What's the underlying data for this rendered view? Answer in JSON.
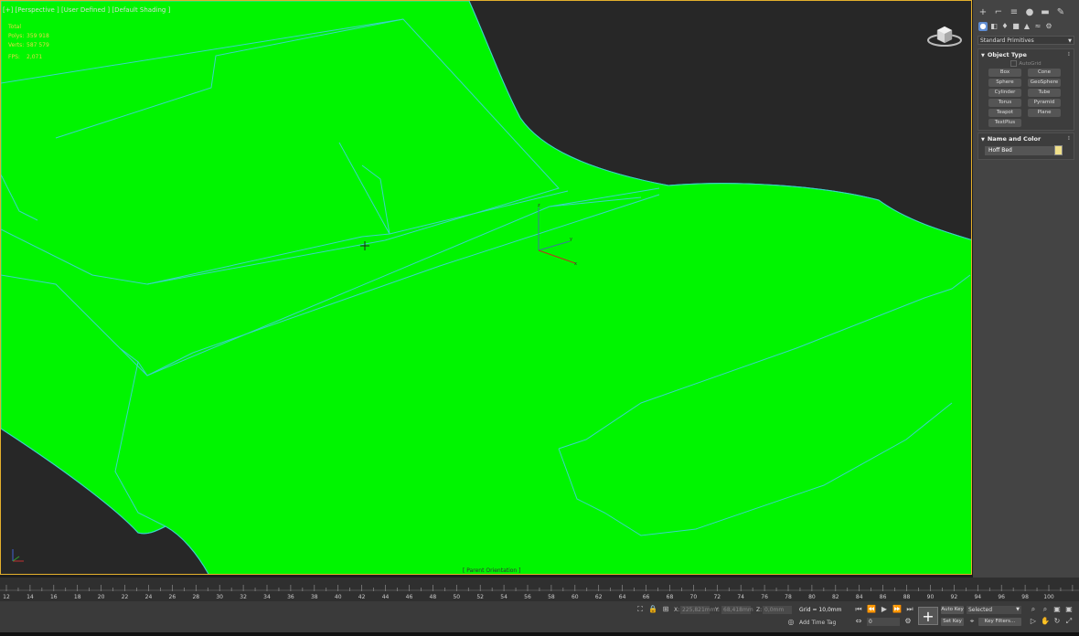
{
  "viewport": {
    "label": "[+] [Perspective ] [User Defined ] [Default Shading ]",
    "stats": [
      {
        "key": "Total",
        "value": ""
      },
      {
        "key": "Polys:",
        "value": "359 918"
      },
      {
        "key": "Verts:",
        "value": "587 579"
      }
    ],
    "fps": {
      "key": "FPS:",
      "value": "2,071"
    },
    "bottom_label": "[ Parent Orientation ]",
    "gizmo": {
      "z": "z",
      "y": "y",
      "x": "x"
    },
    "mesh_color": "#00f500",
    "edge_color": "#3ad4c8"
  },
  "panel": {
    "tabs": [
      "create-icon",
      "modify-icon",
      "hierarchy-icon",
      "motion-icon",
      "display-icon",
      "utilities-icon"
    ],
    "tab_glyphs": [
      "+",
      "⌐",
      "≡",
      "●",
      "▬",
      "✎"
    ],
    "categories": [
      "geometry-icon",
      "shapes-icon",
      "lights-icon",
      "cameras-icon",
      "helpers-icon",
      "spacewarps-icon",
      "systems-icon"
    ],
    "category_glyphs": [
      "●",
      "◧",
      "♦",
      "■",
      "▲",
      "≈",
      "⚙"
    ],
    "dropdown": "Standard Primitives",
    "object_type": {
      "title": "Object Type",
      "autogrid": "AutoGrid",
      "buttons": [
        "Box",
        "Cone",
        "Sphere",
        "GeoSphere",
        "Cylinder",
        "Tube",
        "Torus",
        "Pyramid",
        "Teapot",
        "Plane",
        "TextPlus"
      ]
    },
    "name_and_color": {
      "title": "Name and Color",
      "name": "Hoff Bed",
      "swatch_color": "#f0e08a"
    }
  },
  "timeline": {
    "tick_labels": [
      "12",
      "14",
      "16",
      "18",
      "20",
      "22",
      "24",
      "26",
      "28",
      "30",
      "32",
      "34",
      "36",
      "38",
      "40",
      "42",
      "44",
      "46",
      "48",
      "50",
      "52",
      "54",
      "56",
      "58",
      "60",
      "62",
      "64",
      "66",
      "68",
      "70",
      "72",
      "74",
      "76",
      "78",
      "80",
      "82",
      "84",
      "86",
      "88",
      "90",
      "92",
      "94",
      "96",
      "98",
      "100"
    ]
  },
  "status": {
    "x_label": "X:",
    "x_value": "225,821mm",
    "y_label": "Y:",
    "y_value": "68,418mm",
    "z_label": "Z:",
    "z_value": "0,0mm",
    "grid": "Grid = 10,0mm",
    "add_time_tag": "Add Time Tag",
    "auto_key": "Auto Key",
    "set_key": "Set Key",
    "selected": "Selected",
    "key_filters": "Key Filters...",
    "frame": "0"
  }
}
